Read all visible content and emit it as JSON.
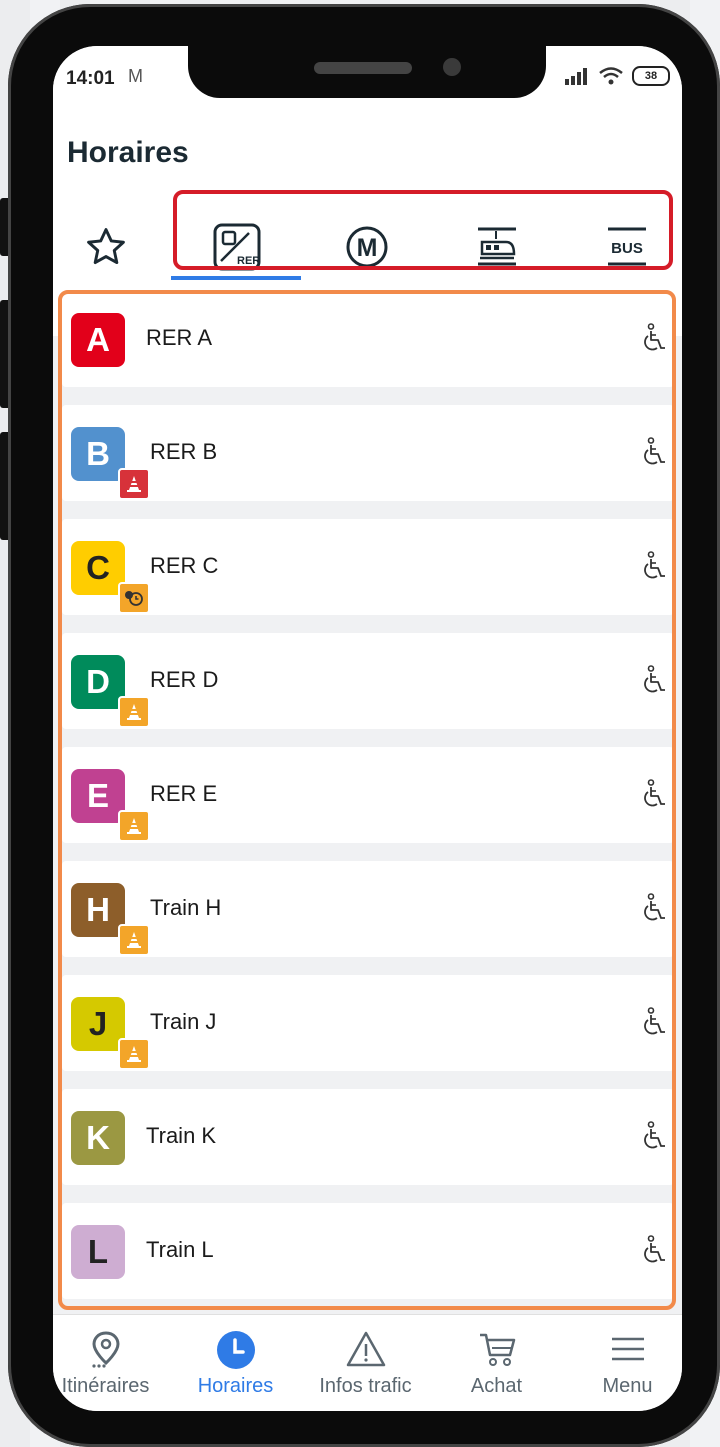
{
  "status_bar": {
    "time": "14:01",
    "battery": "38"
  },
  "header": {
    "title": "Horaires"
  },
  "tabs": [
    {
      "name": "favorites",
      "icon": "star-icon"
    },
    {
      "name": "rer",
      "icon": "rer-train-icon",
      "label": "RER"
    },
    {
      "name": "metro",
      "icon": "metro-icon",
      "label": "M"
    },
    {
      "name": "tram",
      "icon": "tram-icon"
    },
    {
      "name": "bus",
      "icon": "bus-icon",
      "label": "BUS"
    }
  ],
  "lines": [
    {
      "letter": "A",
      "label": "RER A",
      "color": "#e2001a",
      "alert": null
    },
    {
      "letter": "B",
      "label": "RER B",
      "color": "#5291ce",
      "alert": "works-red"
    },
    {
      "letter": "C",
      "label": "RER C",
      "color": "#ffcd00",
      "alert": "schedule"
    },
    {
      "letter": "D",
      "label": "RER D",
      "color": "#008b5b",
      "alert": "works"
    },
    {
      "letter": "E",
      "label": "RER E",
      "color": "#c04191",
      "alert": "works"
    },
    {
      "letter": "H",
      "label": "Train H",
      "color": "#8d5e2a",
      "alert": "works"
    },
    {
      "letter": "J",
      "label": "Train J",
      "color": "#d5c900",
      "alert": "works"
    },
    {
      "letter": "K",
      "label": "Train K",
      "color": "#9b9842",
      "alert": null
    },
    {
      "letter": "L",
      "label": "Train L",
      "color": "#ceadd2",
      "alert": null
    }
  ],
  "bottom_nav": [
    {
      "label": "Itinéraires",
      "icon": "location-pin-icon"
    },
    {
      "label": "Horaires",
      "icon": "clock-icon",
      "active": true
    },
    {
      "label": "Infos trafic",
      "icon": "warning-icon"
    },
    {
      "label": "Achat",
      "icon": "cart-icon"
    },
    {
      "label": "Menu",
      "icon": "hamburger-icon"
    }
  ]
}
